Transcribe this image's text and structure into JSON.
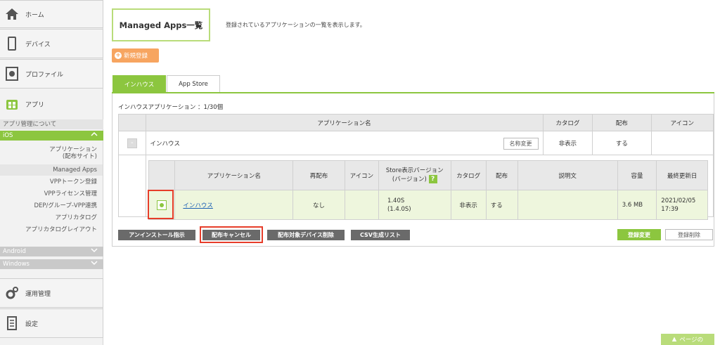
{
  "sidebar": {
    "home": "ホーム",
    "device": "デバイス",
    "profile": "プロファイル",
    "app": "アプリ",
    "about": "アプリ管理について",
    "ios": "iOS",
    "ios_items": [
      "アプリケーション\n(配布サイト)",
      "Managed Apps",
      "VPPトークン登録",
      "VPPライセンス管理",
      "DEP/グループ-VPP連携",
      "アプリカタログ",
      "アプリカタログレイアウト"
    ],
    "android": "Android",
    "windows": "Windows",
    "ops": "運用管理",
    "settings": "設定"
  },
  "main": {
    "title": "Managed Apps一覧",
    "description": "登録されているアプリケーションの一覧を表示します。",
    "new_button": "新規登録",
    "tabs": [
      "インハウス",
      "App Store"
    ],
    "count": "インハウスアプリケーション ：1/30個",
    "outer_headers": [
      "アプリケーション名",
      "カタログ",
      "配布",
      "アイコン"
    ],
    "group": {
      "name": "インハウス",
      "rename": "名称変更",
      "catalog": "非表示",
      "distribution": "する"
    },
    "inner_headers": [
      "アプリケーション名",
      "再配布",
      "アイコン",
      "Store表示バージョン\n(バージョン)",
      "カタログ",
      "配布",
      "説明文",
      "容量",
      "最終更新日"
    ],
    "row": {
      "name": "インハウス",
      "redist": "なし",
      "icon": "",
      "version": "1.40S\n(1.4.0S)",
      "catalog": "非表示",
      "distribution": "する",
      "description": "",
      "size": "3.6 MB",
      "updated": "2021/02/05\n17:39"
    },
    "actions": [
      "アンインストール指示",
      "配布キャンセル",
      "配布対象デバイス削除",
      "CSV生成リスト"
    ],
    "save": "登録変更",
    "delete": "登録削除",
    "page_top": "ページの"
  },
  "colors": {
    "accent": "#8cc63f",
    "orange": "#f7a560",
    "highlight_red": "#e63d2a"
  },
  "icons": [
    "home-icon",
    "device-icon",
    "profile-icon",
    "app-icon",
    "chevron-up-icon",
    "chevron-down-icon",
    "gear-icon",
    "settings-doc-icon",
    "help-icon",
    "plus-icon"
  ]
}
